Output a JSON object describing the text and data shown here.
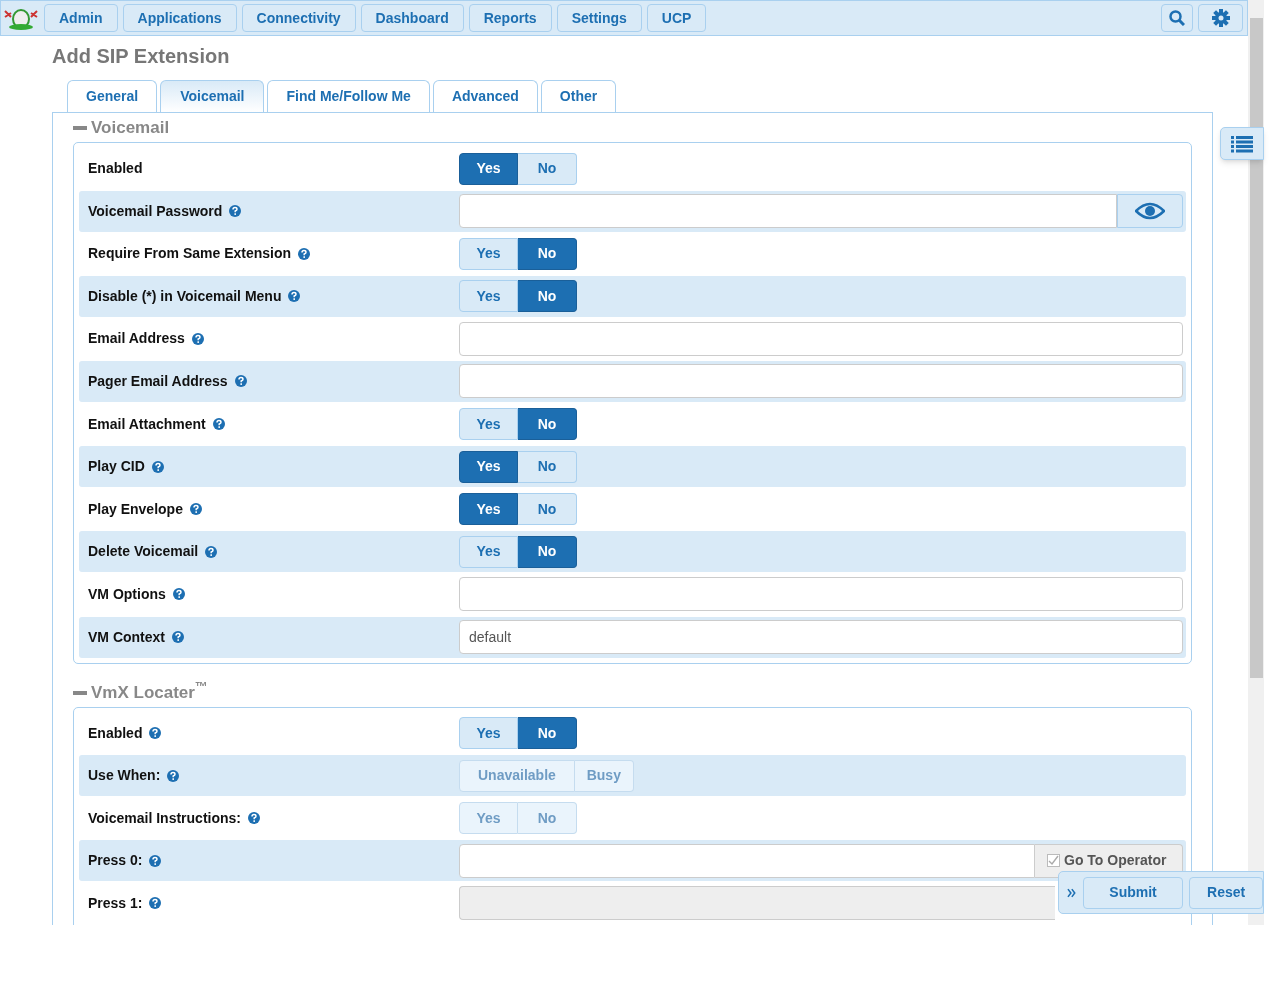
{
  "nav": {
    "items": [
      "Admin",
      "Applications",
      "Connectivity",
      "Dashboard",
      "Reports",
      "Settings",
      "UCP"
    ]
  },
  "page_title": "Add SIP Extension",
  "tabs": [
    {
      "label": "General",
      "selected": false
    },
    {
      "label": "Voicemail",
      "selected": true
    },
    {
      "label": "Find Me/Follow Me",
      "selected": false
    },
    {
      "label": "Advanced",
      "selected": false
    },
    {
      "label": "Other",
      "selected": false
    }
  ],
  "sections": [
    {
      "title": "Voicemail",
      "rows": [
        {
          "label": "Enabled",
          "help": false,
          "kind": "toggle",
          "disabled": false,
          "options": [
            {
              "label": "Yes",
              "selected": true
            },
            {
              "label": "No",
              "selected": false
            }
          ]
        },
        {
          "label": "Voicemail Password",
          "help": true,
          "kind": "password"
        },
        {
          "label": "Require From Same Extension",
          "help": true,
          "kind": "toggle",
          "disabled": false,
          "options": [
            {
              "label": "Yes",
              "selected": false
            },
            {
              "label": "No",
              "selected": true
            }
          ]
        },
        {
          "label": "Disable (*) in Voicemail Menu",
          "help": true,
          "kind": "toggle",
          "disabled": false,
          "options": [
            {
              "label": "Yes",
              "selected": false
            },
            {
              "label": "No",
              "selected": true
            }
          ]
        },
        {
          "label": "Email Address",
          "help": true,
          "kind": "text"
        },
        {
          "label": "Pager Email Address",
          "help": true,
          "kind": "text"
        },
        {
          "label": "Email Attachment",
          "help": true,
          "kind": "toggle",
          "disabled": false,
          "options": [
            {
              "label": "Yes",
              "selected": false
            },
            {
              "label": "No",
              "selected": true
            }
          ]
        },
        {
          "label": "Play CID",
          "help": true,
          "kind": "toggle",
          "disabled": false,
          "options": [
            {
              "label": "Yes",
              "selected": true
            },
            {
              "label": "No",
              "selected": false
            }
          ]
        },
        {
          "label": "Play Envelope",
          "help": true,
          "kind": "toggle",
          "disabled": false,
          "options": [
            {
              "label": "Yes",
              "selected": true
            },
            {
              "label": "No",
              "selected": false
            }
          ]
        },
        {
          "label": "Delete Voicemail",
          "help": true,
          "kind": "toggle",
          "disabled": false,
          "options": [
            {
              "label": "Yes",
              "selected": false
            },
            {
              "label": "No",
              "selected": true
            }
          ]
        },
        {
          "label": "VM Options",
          "help": true,
          "kind": "text"
        },
        {
          "label": "VM Context",
          "help": true,
          "kind": "text",
          "value": "default"
        }
      ]
    },
    {
      "title": "VmX Locater$^{™}$",
      "rows": [
        {
          "label": "Enabled",
          "help": true,
          "kind": "toggle",
          "disabled": false,
          "options": [
            {
              "label": "Yes",
              "selected": false
            },
            {
              "label": "No",
              "selected": true
            }
          ]
        },
        {
          "label": "Use When:",
          "help": true,
          "kind": "toggle",
          "disabled": true,
          "options": [
            {
              "label": "Unavailable",
              "selected": false
            },
            {
              "label": "Busy",
              "selected": false
            }
          ]
        },
        {
          "label": "Voicemail Instructions:",
          "help": true,
          "kind": "toggle",
          "disabled": true,
          "options": [
            {
              "label": "Yes",
              "selected": false
            },
            {
              "label": "No",
              "selected": false
            }
          ]
        },
        {
          "label": "Press 0:",
          "help": true,
          "kind": "text-check",
          "check": {
            "label": "Go To Operator",
            "checked": true
          }
        },
        {
          "label": "Press 1:",
          "help": true,
          "kind": "text",
          "disabled": true
        }
      ]
    }
  ],
  "actions": [
    "Submit",
    "Reset"
  ]
}
